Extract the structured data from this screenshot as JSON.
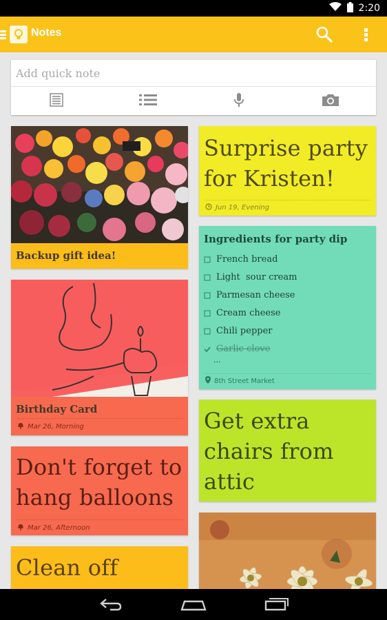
{
  "status_bar": {
    "time": "2:20"
  },
  "app_bar": {
    "title": "Notes"
  },
  "quick_note": {
    "placeholder": "Add quick note"
  },
  "notes": {
    "backup_gift": {
      "title": "Backup gift idea!"
    },
    "surprise_party": {
      "text_line1": "Surprise party",
      "text_line2": "for Kristen!",
      "reminder": "Jun 19, Evening"
    },
    "ingredients": {
      "title": "Ingredients for party dip",
      "items": [
        {
          "label": "French bread",
          "checked": false
        },
        {
          "label": "Light  sour cream",
          "checked": false
        },
        {
          "label": "Parmesan cheese",
          "checked": false
        },
        {
          "label": "Cream cheese",
          "checked": false
        },
        {
          "label": "Chili pepper",
          "checked": false
        },
        {
          "label": "Garlic clove",
          "checked": true
        }
      ],
      "more": "...",
      "location": "8th Street Market"
    },
    "birthday_card": {
      "title": "Birthday Card",
      "reminder": "Mar 26, Morning"
    },
    "chairs": {
      "text_line1": "Get extra",
      "text_line2": "chairs from",
      "text_line3": "attic"
    },
    "balloons": {
      "text_line1": "Don't forget to",
      "text_line2": "hang balloons",
      "reminder": "Mar 26, Afternoon"
    },
    "clean_off": {
      "text_line1": "Clean off"
    }
  },
  "colors": {
    "app_bar": "#fbc21a",
    "yellow_note": "#f2ec26",
    "teal_note": "#72dcb8",
    "orange_note": "#f76a4f",
    "lime_note": "#bce52a",
    "amber_note": "#fcbd1a"
  }
}
